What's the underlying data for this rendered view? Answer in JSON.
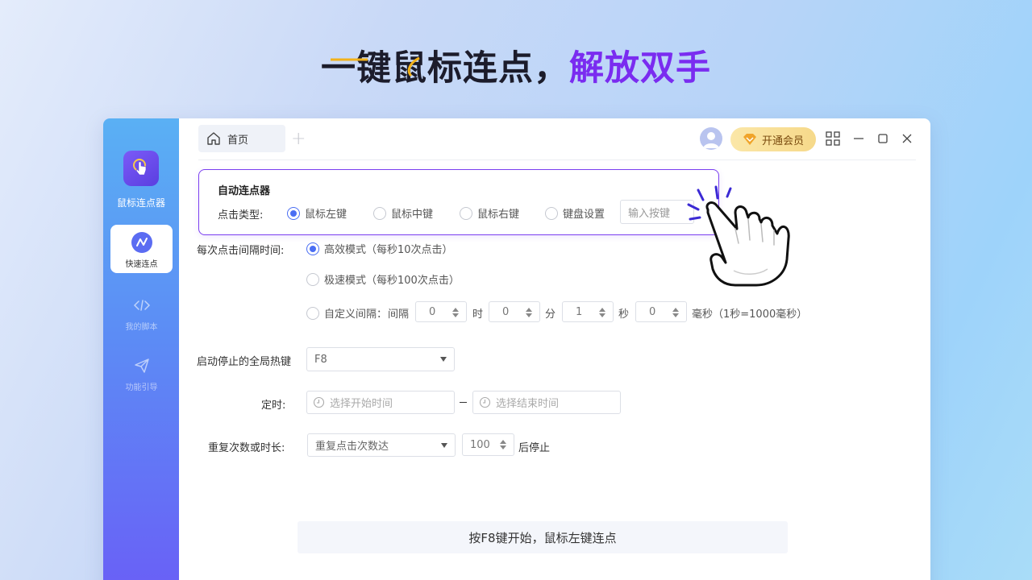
{
  "headline": {
    "dark": "一键鼠标连点，",
    "accent": "解放双手"
  },
  "app": {
    "name": "鼠标连点器",
    "nav": [
      {
        "label": "快速连点",
        "icon": "trend-line-icon",
        "active": true
      },
      {
        "label": "我的脚本",
        "icon": "code-icon",
        "active": false
      },
      {
        "label": "功能引导",
        "icon": "send-icon",
        "active": false
      }
    ]
  },
  "tabs": [
    {
      "label": "首页",
      "icon": "home-icon"
    }
  ],
  "header": {
    "vip_label": "开通会员"
  },
  "panel": {
    "title": "自动连点器",
    "click_type_label": "点击类型:",
    "click_types": [
      "鼠标左键",
      "鼠标中键",
      "鼠标右键",
      "键盘设置"
    ],
    "selected_click_type": "鼠标左键",
    "key_placeholder": "输入按键"
  },
  "interval": {
    "label": "每次点击间隔时间:",
    "modes": [
      "高效模式（每秒10次点击）",
      "极速模式（每秒100次点击）",
      "自定义间隔："
    ],
    "selected_mode": "高效模式（每秒10次点击）",
    "custom_prefix": "间隔",
    "fields": [
      {
        "value": "0",
        "unit": "时"
      },
      {
        "value": "0",
        "unit": "分"
      },
      {
        "value": "1",
        "unit": "秒"
      },
      {
        "value": "0",
        "unit": "毫秒（1秒=1000毫秒）"
      }
    ]
  },
  "hotkey": {
    "label": "启动停止的全局热键",
    "value": "F8"
  },
  "timer": {
    "label": "定时:",
    "start_placeholder": "选择开始时间",
    "end_placeholder": "选择结束时间"
  },
  "repeat": {
    "label": "重复次数或时长:",
    "select_value": "重复点击次数达",
    "count": "100",
    "suffix": "后停止"
  },
  "status": "按F8键开始，鼠标左键连点",
  "colors": {
    "accent": "#7a2cf0",
    "primary": "#4a6ef3",
    "vip": "#f6d98a"
  }
}
